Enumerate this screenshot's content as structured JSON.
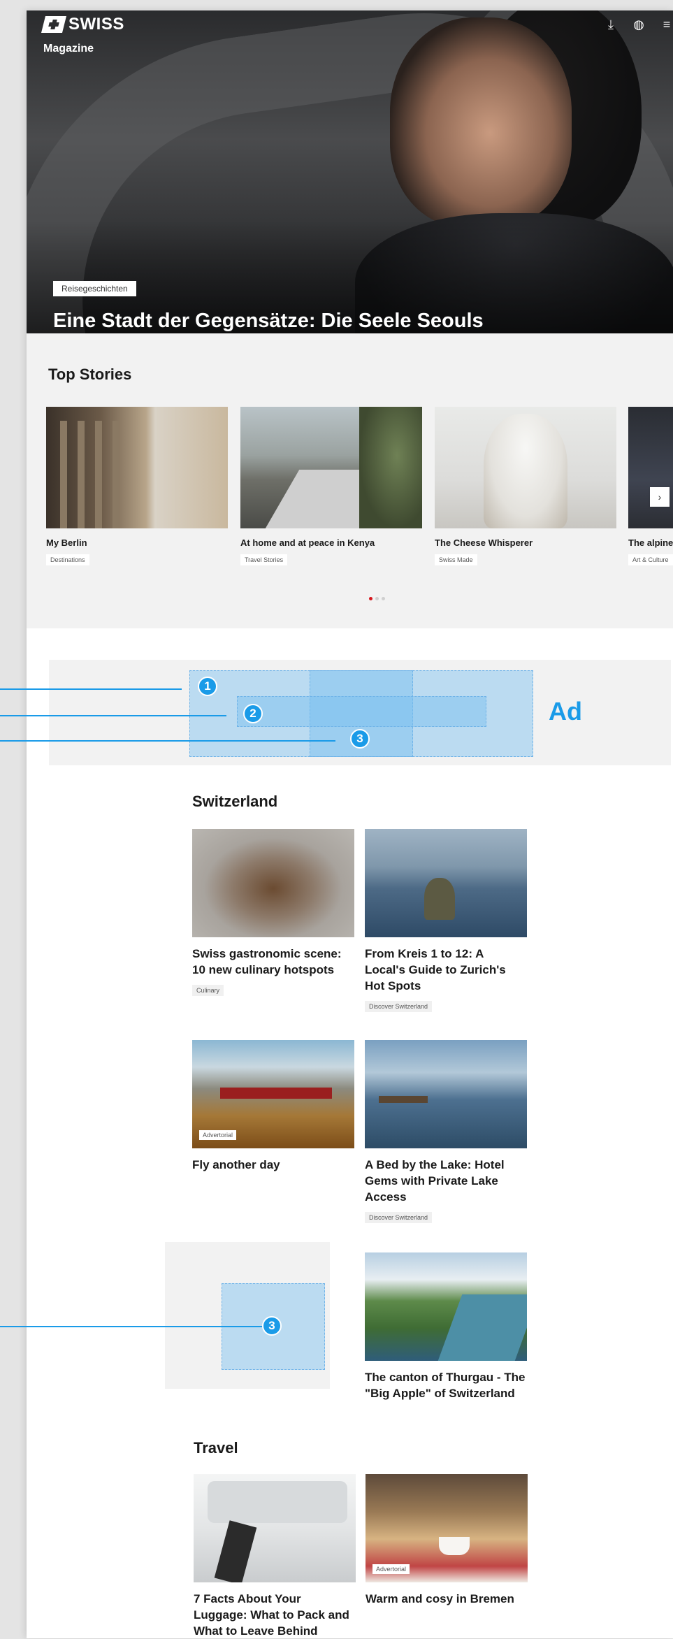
{
  "header": {
    "brand": "SWISS",
    "sub_brand": "Magazine",
    "icons": [
      "download-icon",
      "globe-icon",
      "menu-icon"
    ]
  },
  "hero": {
    "tag": "Reisegeschichten",
    "title": "Eine Stadt der Gegensätze: Die Seele Seouls"
  },
  "top_stories": {
    "title": "Top Stories",
    "items": [
      {
        "title": "My Berlin",
        "tag": "Destinations"
      },
      {
        "title": "At home and at peace in Kenya",
        "tag": "Travel Stories"
      },
      {
        "title": "The Cheese Whisperer",
        "tag": "Swiss Made"
      },
      {
        "title": "The alpine",
        "tag": "Art & Culture"
      }
    ],
    "next_label": "›"
  },
  "ad": {
    "label": "Ad",
    "markers": [
      "1",
      "2",
      "3"
    ]
  },
  "switzerland": {
    "title": "Switzerland",
    "items": [
      {
        "title": "Swiss gastronomic scene: 10 new culinary hotspots",
        "tag": "Culinary"
      },
      {
        "title": "From Kreis 1 to 12: A Local's Guide to Zurich's Hot Spots",
        "tag": "Discover Switzerland"
      },
      {
        "title": "Fly another day",
        "badge": "Advertorial"
      },
      {
        "title": "A Bed by the Lake: Hotel Gems with Private Lake Access",
        "tag": "Discover Switzerland"
      },
      {
        "title": "The canton of Thurgau - The \"Big Apple\" of Switzerland"
      }
    ],
    "ad_marker": "3"
  },
  "travel": {
    "title": "Travel",
    "items": [
      {
        "title": "7 Facts About Your Luggage: What to Pack and What to Leave Behind"
      },
      {
        "title": "Warm and cosy in Bremen",
        "badge": "Advertorial"
      }
    ]
  },
  "colors": {
    "accent": "#1a9be8",
    "swiss_red": "#d6161d"
  }
}
